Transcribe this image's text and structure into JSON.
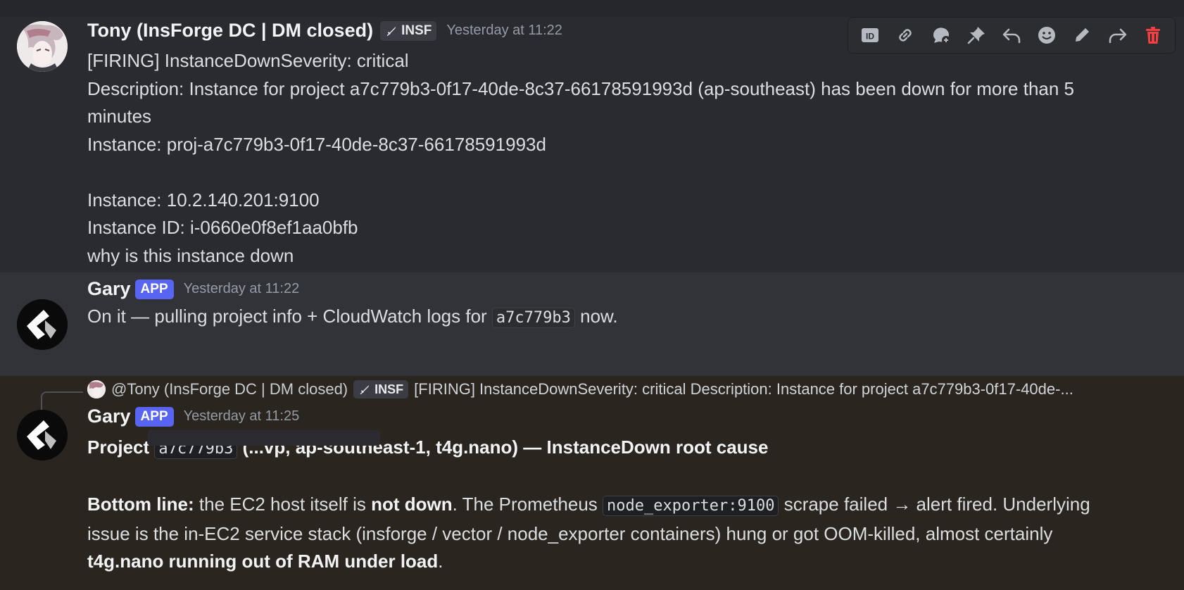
{
  "toolbar": {
    "icons": [
      "copy-id-icon",
      "copy-link-icon",
      "thread-icon",
      "pin-icon",
      "reply-icon",
      "add-reaction-icon",
      "edit-icon",
      "forward-icon",
      "delete-icon"
    ]
  },
  "messages": [
    {
      "author": "Tony (InsForge DC | DM closed)",
      "tag": "INSF",
      "timestamp": "Yesterday at 11:22",
      "lines": [
        "[FIRING] InstanceDownSeverity: critical",
        "Description: Instance for project a7c779b3-0f17-40de-8c37-66178591993d (ap-southeast) has been down for more than 5",
        "minutes",
        "Instance: proj-a7c779b3-0f17-40de-8c37-66178591993d",
        "",
        "Instance: 10.2.140.201:9100",
        "Instance ID: i-0660e0f8ef1aa0bfb",
        "why is this instance down"
      ]
    },
    {
      "author": "Gary",
      "badge": "APP",
      "timestamp": "Yesterday at 11:22",
      "text_before": "On it — pulling project info + CloudWatch logs for ",
      "code": "a7c779b3",
      "text_after": " now."
    },
    {
      "reply": {
        "author": "@Tony (InsForge DC | DM closed)",
        "tag": "INSF",
        "text": "[FIRING] InstanceDownSeverity: critical Description: Instance for project a7c779b3-0f17-40de-..."
      },
      "author": "Gary",
      "badge": "APP",
      "timestamp": "Yesterday at 11:25",
      "heading": {
        "prefix": "Project",
        "code": "a7c779b3",
        "suffix": "(...vp, ap-southeast-1, t4g.nano) — InstanceDown root cause"
      },
      "bottom_line": {
        "label": "Bottom line:",
        "t1": " the EC2 host itself is ",
        "b1": "not down",
        "t2": ". The Prometheus ",
        "code": "node_exporter:9100",
        "t3": " scrape failed → alert fired. Underlying",
        "line2": "issue is the in-EC2 service stack (insforge / vector / node_exporter containers) hung or got OOM-killed, almost certainly",
        "b2": "t4g.nano running out of RAM under load",
        "t4": "."
      }
    }
  ]
}
